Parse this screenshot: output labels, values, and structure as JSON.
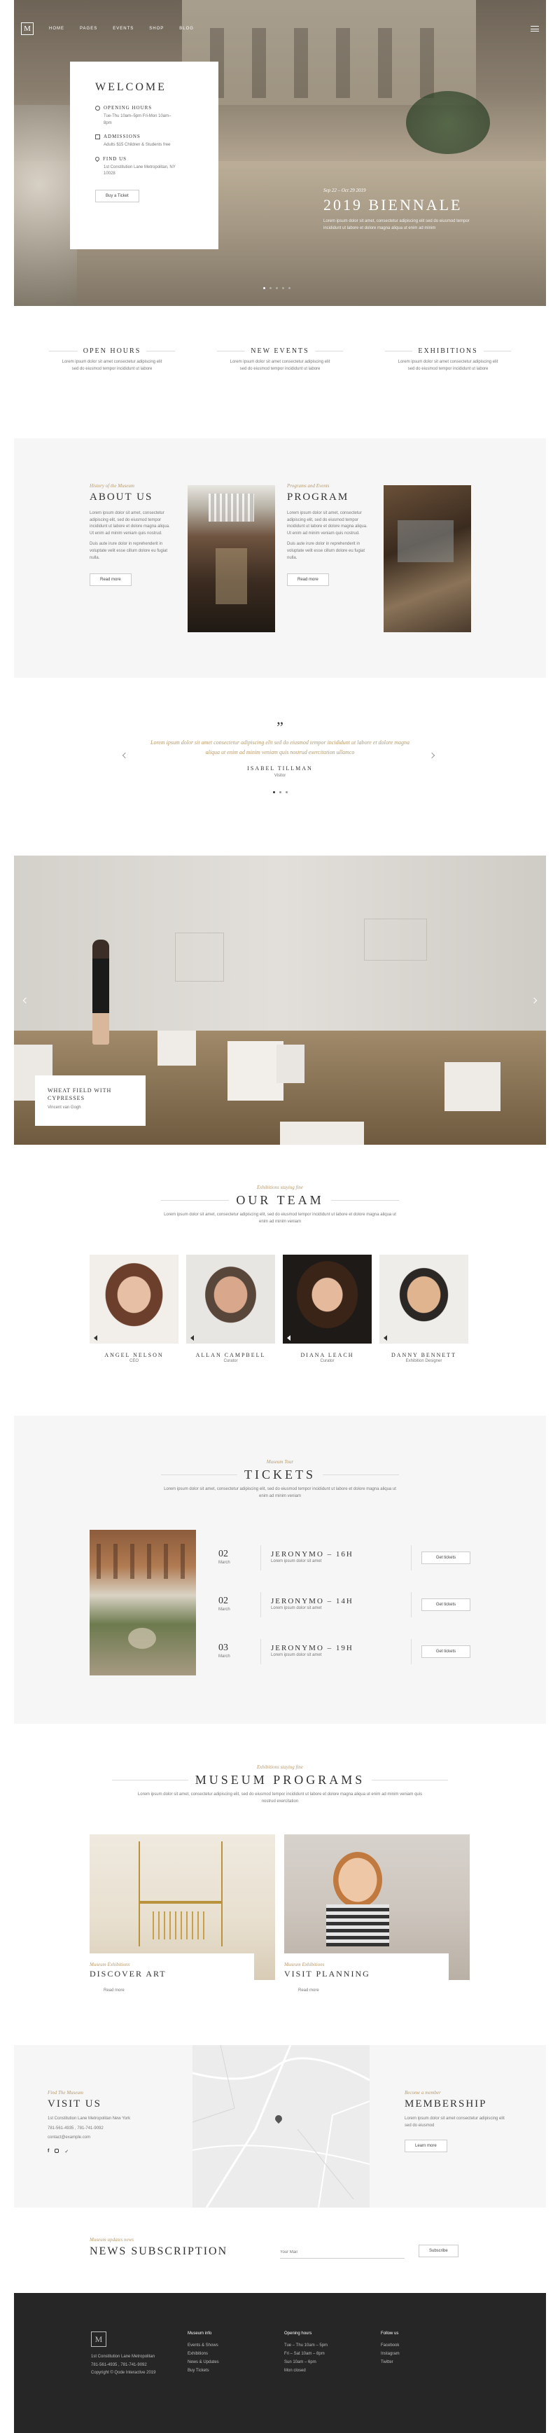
{
  "nav": {
    "logo": "M",
    "items": [
      {
        "label": "HOME"
      },
      {
        "label": "PAGES"
      },
      {
        "label": "EVENTS"
      },
      {
        "label": "SHOP"
      },
      {
        "label": "BLOG"
      }
    ]
  },
  "hero": {
    "welcome_title": "WELCOME",
    "opening_hours_label": "OPENING HOURS",
    "opening_hours_text": "Tue-Thu 10am–5pm Fri-Mon 10am–8pm",
    "admissions_label": "ADMISSIONS",
    "admissions_text": "Adults $15 Children & Students free",
    "find_us_label": "FIND US",
    "find_us_text": "1st Constitution Lane Metropolitan, NY 10028",
    "tickets_button": "Buy a Ticket",
    "event_date": "Sep 22 – Oct 29 2019",
    "event_title": "2019 BIENNALE",
    "event_text": "Lorem ipsum dolor sit amet, consectetur adipiscing elit sed do eiusmod tempor incididunt ut labore et dolore magna aliqua ut enim ad minim"
  },
  "info": [
    {
      "title": "OPEN HOURS",
      "text": "Lorem ipsum dolor sit amet consectetur adipiscing elit sed do eiusmod tempor incididunt ut labore"
    },
    {
      "title": "NEW EVENTS",
      "text": "Lorem ipsum dolor sit amet consectetur adipiscing elit sed do eiusmod tempor incididunt ut labore"
    },
    {
      "title": "EXHIBITIONS",
      "text": "Lorem ipsum dolor sit amet consectetur adipiscing elit sed do eiusmod tempor incididunt ut labore"
    }
  ],
  "about": {
    "label": "History of the Museum",
    "title": "ABOUT US",
    "text1": "Lorem ipsum dolor sit amet, consectetur adipiscing elit, sed do eiusmod tempor incididunt ut labore et dolore magna aliqua. Ut enim ad minim veniam quis nostrud.",
    "text2": "Duis aute irure dolor in reprehenderit in voluptate velit esse cillum dolore eu fugiat nulla.",
    "button": "Read more"
  },
  "program": {
    "label": "Programs and Events",
    "title": "PROGRAM",
    "text1": "Lorem ipsum dolor sit amet, consectetur adipiscing elit, sed do eiusmod tempor incididunt ut labore et dolore magna aliqua. Ut enim ad minim veniam quis nostrud.",
    "text2": "Duis aute irure dolor in reprehenderit in voluptate velit esse cillum dolore eu fugiat nulla.",
    "button": "Read more"
  },
  "testimonial": {
    "quote_mark": "”",
    "text": "Lorem ipsum dolor sit amet consectetur adipiscing elit sed do eiusmod tempor incididunt ut labore et dolore magna aliqua ut enim ad minim veniam quis nostrud exercitation ullamco",
    "author": "ISABEL TILLMAN",
    "role": "Visitor"
  },
  "gallery": {
    "caption_title": "WHEAT FIELD WITH CYPRESSES",
    "caption_sub": "Vincent van Gogh"
  },
  "team": {
    "label": "Exhibitions staying fine",
    "title": "OUR TEAM",
    "text": "Lorem ipsum dolor sit amet, consectetur adipiscing elit, sed do eiusmod tempor incididunt ut labore et dolore magna aliqua ut enim ad minim veniam",
    "members": [
      {
        "name": "ANGEL NELSON",
        "role": "CEO"
      },
      {
        "name": "ALLAN CAMPBELL",
        "role": "Curator"
      },
      {
        "name": "DIANA LEACH",
        "role": "Curator"
      },
      {
        "name": "DANNY BENNETT",
        "role": "Exhibition Designer"
      }
    ]
  },
  "tickets": {
    "label": "Museum Tour",
    "title": "TICKETS",
    "text": "Lorem ipsum dolor sit amet, consectetur adipiscing elit, sed do eiusmod tempor incididunt ut labore et dolore magna aliqua ut enim ad minim veniam",
    "rows": [
      {
        "day": "02",
        "month": "March",
        "title": "JERONYMO – 16H",
        "desc": "Lorem ipsum dolor sit amet",
        "button": "Get tickets"
      },
      {
        "day": "02",
        "month": "March",
        "title": "JERONYMO – 14H",
        "desc": "Lorem ipsum dolor sit amet",
        "button": "Get tickets"
      },
      {
        "day": "03",
        "month": "March",
        "title": "JERONYMO – 19H",
        "desc": "Lorem ipsum dolor sit amet",
        "button": "Get tickets"
      }
    ]
  },
  "programs": {
    "label": "Exhibitions staying fine",
    "title": "MUSEUM PROGRAMS",
    "text": "Lorem ipsum dolor sit amet, consectetur adipiscing elit, sed do eiusmod tempor incididunt ut labore et dolore magna aliqua ut enim ad minim veniam quis nostrud exercitation",
    "cards": [
      {
        "label": "Museum Exhibitions",
        "title": "DISCOVER ART",
        "button": "Read more"
      },
      {
        "label": "Museum Exhibitions",
        "title": "VISIT PLANNING",
        "button": "Read more"
      }
    ]
  },
  "visit": {
    "label": "Find The Museum",
    "title": "VISIT US",
    "address": "1st Constitution Lane Metropolitan New York",
    "phone": "781-561-4935 , 781-741-9092",
    "email": "contact@example.com"
  },
  "membership": {
    "label": "Become a member",
    "title": "MEMBERSHIP",
    "text": "Lorem ipsum dolor sit amet consectetur adipiscing elit sed do eiusmod",
    "button": "Learn more"
  },
  "newsletter": {
    "label": "Museum updates news",
    "title": "NEWS SUBSCRIPTION",
    "placeholder": "Your Mail",
    "button": "Subscribe"
  },
  "footer": {
    "logo": "M",
    "address": "1st Constitution Lane Metropolitan",
    "phone": "781-561-4935 , 781-741-9092",
    "copyright": "Copyright © Qode Interactive 2019",
    "col1_title": "Museum info",
    "col1_items": [
      "Events & Shows",
      "Exhibitions",
      "News & Updates",
      "Buy Tickets"
    ],
    "col2_title": "Opening hours",
    "col2_items": [
      "Tue – Thu 10am – 5pm",
      "Fri – Sat 10am – 8pm",
      "Sun 10am – 6pm",
      "Mon closed"
    ],
    "col3_title": "Follow us",
    "col3_items": [
      "Facebook",
      "Instagram",
      "Twitter"
    ]
  },
  "colors": {
    "accent": "#b79a6b",
    "footer_bg": "#262626",
    "section_bg": "#f6f6f6"
  }
}
